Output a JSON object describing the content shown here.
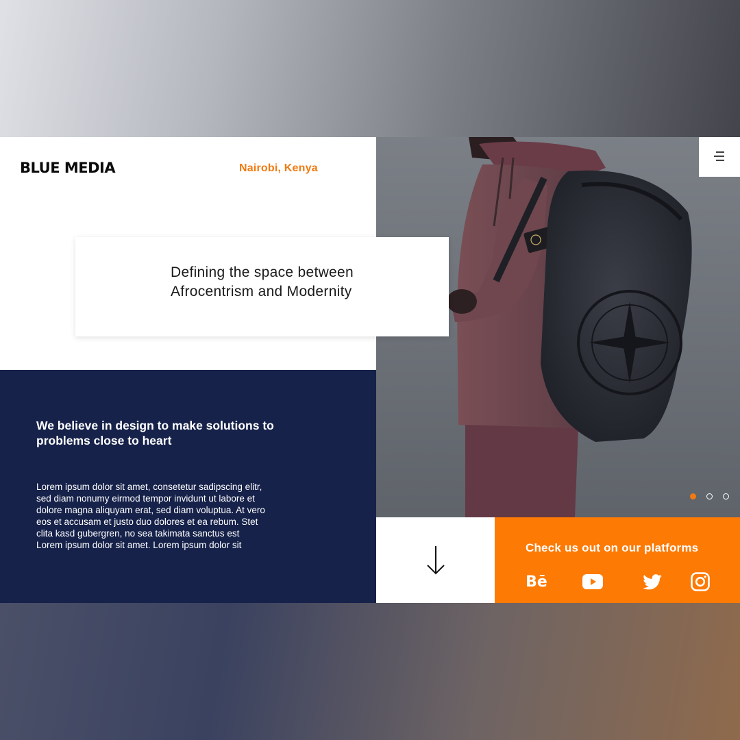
{
  "brand": {
    "logo": "BLUE MEDIA",
    "location": "Nairobi, Kenya"
  },
  "hero": {
    "tagline_line1": "Defining the space between",
    "tagline_line2": "Afrocentrism and Modernity"
  },
  "about": {
    "heading_line1": "We believe in design to make solutions to",
    "heading_line2": "problems close to heart",
    "body_lines": [
      "Lorem ipsum dolor sit amet, consetetur sadipscing elitr,",
      "sed diam nonumy eirmod tempor invidunt ut labore et",
      "dolore magna aliquyam erat, sed diam voluptua. At vero",
      "eos et accusam et justo duo dolores et ea rebum. Stet",
      "clita kasd gubergren, no sea takimata sanctus est",
      "Lorem ipsum dolor sit amet. Lorem ipsum dolor sit"
    ]
  },
  "slider": {
    "slide_count": 3,
    "active_slide": 1
  },
  "platforms": {
    "title": "Check us out on our platforms",
    "icons": [
      "behance-icon",
      "youtube-icon",
      "twitter-icon",
      "instagram-icon"
    ],
    "behance_label": "Bē"
  },
  "colors": {
    "accent": "#fd7a05",
    "navy": "#16224a",
    "location_text": "#f07b12"
  },
  "icons": {
    "menu": "menu-icon",
    "scroll": "arrow-down-icon"
  }
}
